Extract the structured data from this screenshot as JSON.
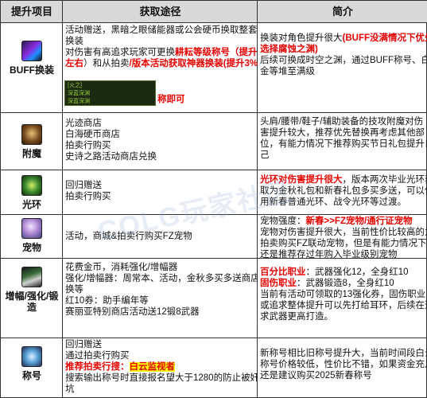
{
  "header": {
    "col1": "提升项目",
    "col2": "获取途径",
    "col3": "简介"
  },
  "watermark": "COLG玩家社区",
  "rows": {
    "buff": {
      "label": "BUFF换装",
      "icon": "buff-swap-icon",
      "source": {
        "l1": "活动赠送，黑暗之眼储能器或公会硬币换取整套buff",
        "l2": "换装",
        "l3a": "对伤害有高追求玩家可更换",
        "l3b": "耕耘等级称号（提升1%",
        "l4a": "左右",
        "l4b": "）和从拍卖",
        "l4c": "/版本活动获取神器换装(提升3%左",
        "mini1": "[火之]",
        "mini2": "深蓝深渊",
        "mini3": "深蓝深渊",
        "l5": "称即可"
      },
      "intro": {
        "l1a": "换装对角色提升很大",
        "l1b": "(BUFF没满情况下优先",
        "l2": "选择腐蚀之渊)",
        "l3": "后续可换成时空之渊，通过BUFF称号、白",
        "l4": "金等堆至满级"
      }
    },
    "fumo": {
      "label": "附魔",
      "icon": "enchant-icon",
      "source": {
        "l1": "光迹商店",
        "l2": "白海硬币商店",
        "l3": "拍卖行购买",
        "l4": "史诗之路活动商店兑换"
      },
      "intro": {
        "l1": "头肩/腰带/鞋子/辅助装备的技攻附魔对伤",
        "l2": "害提升较大，推荐优先替换再考虑其他部",
        "l3": "位，有能力情况下推荐购买节日礼包提升自",
        "l4": "己"
      }
    },
    "halo": {
      "label": "光环",
      "icon": "halo-icon",
      "source": {
        "l1": "回归赠送",
        "l2": "拍卖行购买"
      },
      "intro": {
        "l1a": "光环对伤害提升很大",
        "l1b": "，版本两次毕业光环获",
        "l2": "取为金秋礼包和新春礼包多买多送，可以使",
        "l3": "用新春普通光环、战令光环等过渡。"
      }
    },
    "pet": {
      "label": "宠物",
      "icon": "pet-icon",
      "source": {
        "l1": "活动，商城&拍卖行购买FZ宠物"
      },
      "intro": {
        "l1a": "宠物强度：",
        "l1b": "新春>>FZ宠物/通行证宠物",
        "l2": "宠物对伤害提升很大，当前性价比较高的为",
        "l3": "拍卖购买FZ联动宠物，但是有能力情况下",
        "l4": "还是推荐存过年购入毕业级别宠物"
      }
    },
    "amplify": {
      "label": "增幅/强化/锻造",
      "label1": "增幅/强化/锻",
      "label2": "造",
      "icon": "amplify-icon",
      "source": {
        "l1": "花费金币，消耗强化/增幅器",
        "l2": "强化/增幅器：周常本、活动，金秋多买多送商店兑",
        "l3": "换等",
        "l4": "红10券：助手编年等",
        "l5": "赛丽亚特别商店活动送12锻8武器"
      },
      "intro": {
        "l1a": "百分比职业",
        "l1b": "：武器强化12，全身红10",
        "l2a": "固伤职业",
        "l2b": "：武器锻造8，全身红10",
        "l3": "当前有活动可领取的13强化券，固伤职业",
        "l4": "或追求整体提升可以先打给耳环，后续在追",
        "l5": "求武器更高打造。"
      }
    },
    "title": {
      "label": "称号",
      "icon": "title-icon",
      "source": {
        "l1": "回归赠送",
        "l2": "通过拍卖行购买",
        "l3a": "推荐拍卖行搜：",
        "l3b": "白云监视者",
        "l4": "搜索输出称号时直接报名望大于1280的防止被奸商",
        "l5": "坑"
      },
      "intro": {
        "l1": "新称号相比旧称号提升大，当前时间段白云",
        "l2": "称号价格较低，性价比不错，如果资金充足",
        "l3": "还是建议购买2025新春称号"
      }
    }
  },
  "colors": {
    "header_bg": "#d9d9d9",
    "emphasis_red": "#e60000",
    "highlight": "#ffff00",
    "border": "#333333"
  }
}
